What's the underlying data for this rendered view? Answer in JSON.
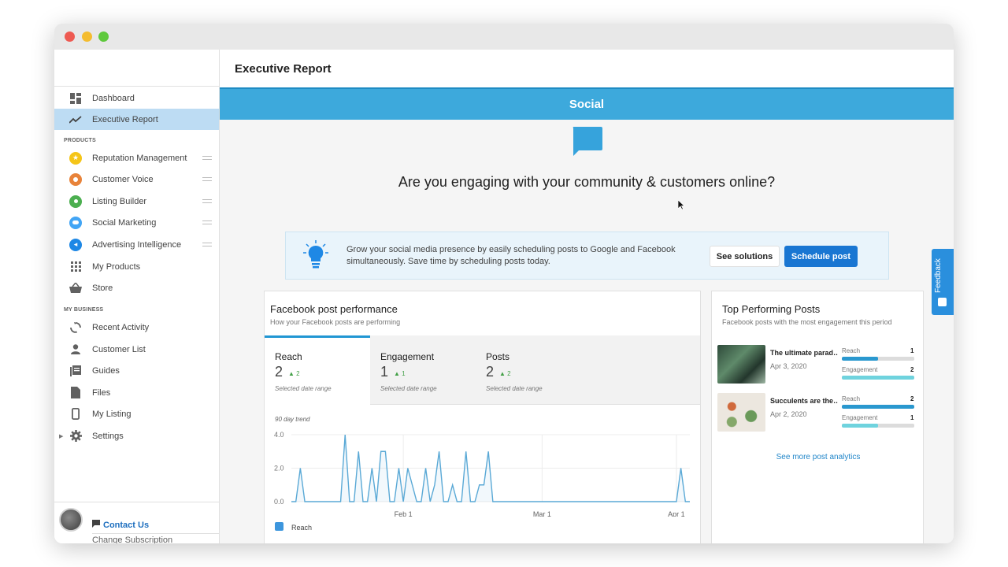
{
  "sidebar": {
    "items": [
      {
        "label": "Dashboard",
        "icon": "dashboard-icon"
      },
      {
        "label": "Executive Report",
        "icon": "trend-icon"
      }
    ],
    "products_heading": "PRODUCTS",
    "products": [
      {
        "label": "Reputation Management",
        "icon": "star-icon",
        "color": "#f5c518"
      },
      {
        "label": "Customer Voice",
        "icon": "voice-icon",
        "color": "#e8833a"
      },
      {
        "label": "Listing Builder",
        "icon": "location-pin-icon",
        "color": "#4caf50"
      },
      {
        "label": "Social Marketing",
        "icon": "social-bubble-icon",
        "color": "#42a5f5"
      },
      {
        "label": "Advertising Intelligence",
        "icon": "megaphone-icon",
        "color": "#1e88e5"
      },
      {
        "label": "My Products",
        "icon": "apps-grid-icon"
      },
      {
        "label": "Store",
        "icon": "basket-icon"
      }
    ],
    "business_heading": "MY BUSINESS",
    "business": [
      {
        "label": "Recent Activity",
        "icon": "refresh-icon"
      },
      {
        "label": "Customer List",
        "icon": "person-icon"
      },
      {
        "label": "Guides",
        "icon": "guides-icon"
      },
      {
        "label": "Files",
        "icon": "file-icon"
      },
      {
        "label": "My Listing",
        "icon": "phone-icon"
      },
      {
        "label": "Settings",
        "icon": "gear-icon"
      }
    ],
    "contact_label": "Contact Us",
    "change_subscription": "Change Subscription"
  },
  "header": {
    "title": "Executive Report"
  },
  "section": {
    "title": "Social"
  },
  "hero": {
    "headline": "Are you engaging with your community & customers online?"
  },
  "tip": {
    "text": "Grow your social media presence by easily scheduling posts to Google and Facebook simultaneously. Save time by scheduling posts today.",
    "see_solutions": "See solutions",
    "schedule_post": "Schedule post"
  },
  "fb_card": {
    "title": "Facebook post performance",
    "subtitle": "How your Facebook posts are performing",
    "metrics": [
      {
        "name": "Reach",
        "value": "2",
        "delta": "2",
        "footnote": "Selected date range"
      },
      {
        "name": "Engagement",
        "value": "1",
        "delta": "1",
        "footnote": "Selected date range"
      },
      {
        "name": "Posts",
        "value": "2",
        "delta": "2",
        "footnote": "Selected date range"
      }
    ],
    "trend_label": "90 day trend",
    "legend": "Reach"
  },
  "chart_data": {
    "type": "line",
    "series": [
      {
        "name": "Reach",
        "color": "#5aa9d6",
        "values": [
          0,
          0,
          2,
          0,
          0,
          0,
          0,
          0,
          0,
          0,
          0,
          0,
          4,
          0,
          0,
          3,
          0,
          0,
          2,
          0,
          3,
          3,
          0,
          0,
          2,
          0,
          2,
          1,
          0,
          0,
          2,
          0,
          1,
          3,
          0,
          0,
          1,
          0,
          0,
          3,
          0,
          0,
          1,
          1,
          3,
          0,
          0,
          0,
          0,
          0,
          0,
          0,
          0,
          0,
          0,
          0,
          0,
          0,
          0,
          0,
          0,
          0,
          0,
          0,
          0,
          0,
          0,
          0,
          0,
          0,
          0,
          0,
          0,
          0,
          0,
          0,
          0,
          0,
          0,
          0,
          0,
          0,
          0,
          0,
          0,
          0,
          0,
          2,
          0,
          0
        ]
      }
    ],
    "x_ticks": [
      "Feb 1",
      "Mar 1",
      "Apr 1"
    ],
    "x_tick_index": [
      25,
      56,
      86
    ],
    "y_ticks": [
      "0.0",
      "2.0",
      "4.0"
    ],
    "ylim": [
      0,
      4
    ],
    "grid": true
  },
  "top_card": {
    "title": "Top Performing Posts",
    "subtitle": "Facebook posts with the most engagement this period",
    "posts": [
      {
        "title": "The ultimate parad…",
        "date": "Apr 3, 2020",
        "reach_label": "Reach",
        "reach": "1",
        "reach_frac": 0.5,
        "engagement_label": "Engagement",
        "engagement": "2",
        "engagement_frac": 1.0
      },
      {
        "title": "Succulents are the…",
        "date": "Apr 2, 2020",
        "reach_label": "Reach",
        "reach": "2",
        "reach_frac": 1.0,
        "engagement_label": "Engagement",
        "engagement": "1",
        "engagement_frac": 0.5
      }
    ],
    "see_more": "See more post analytics"
  },
  "feedback": {
    "label": "Feedback"
  }
}
